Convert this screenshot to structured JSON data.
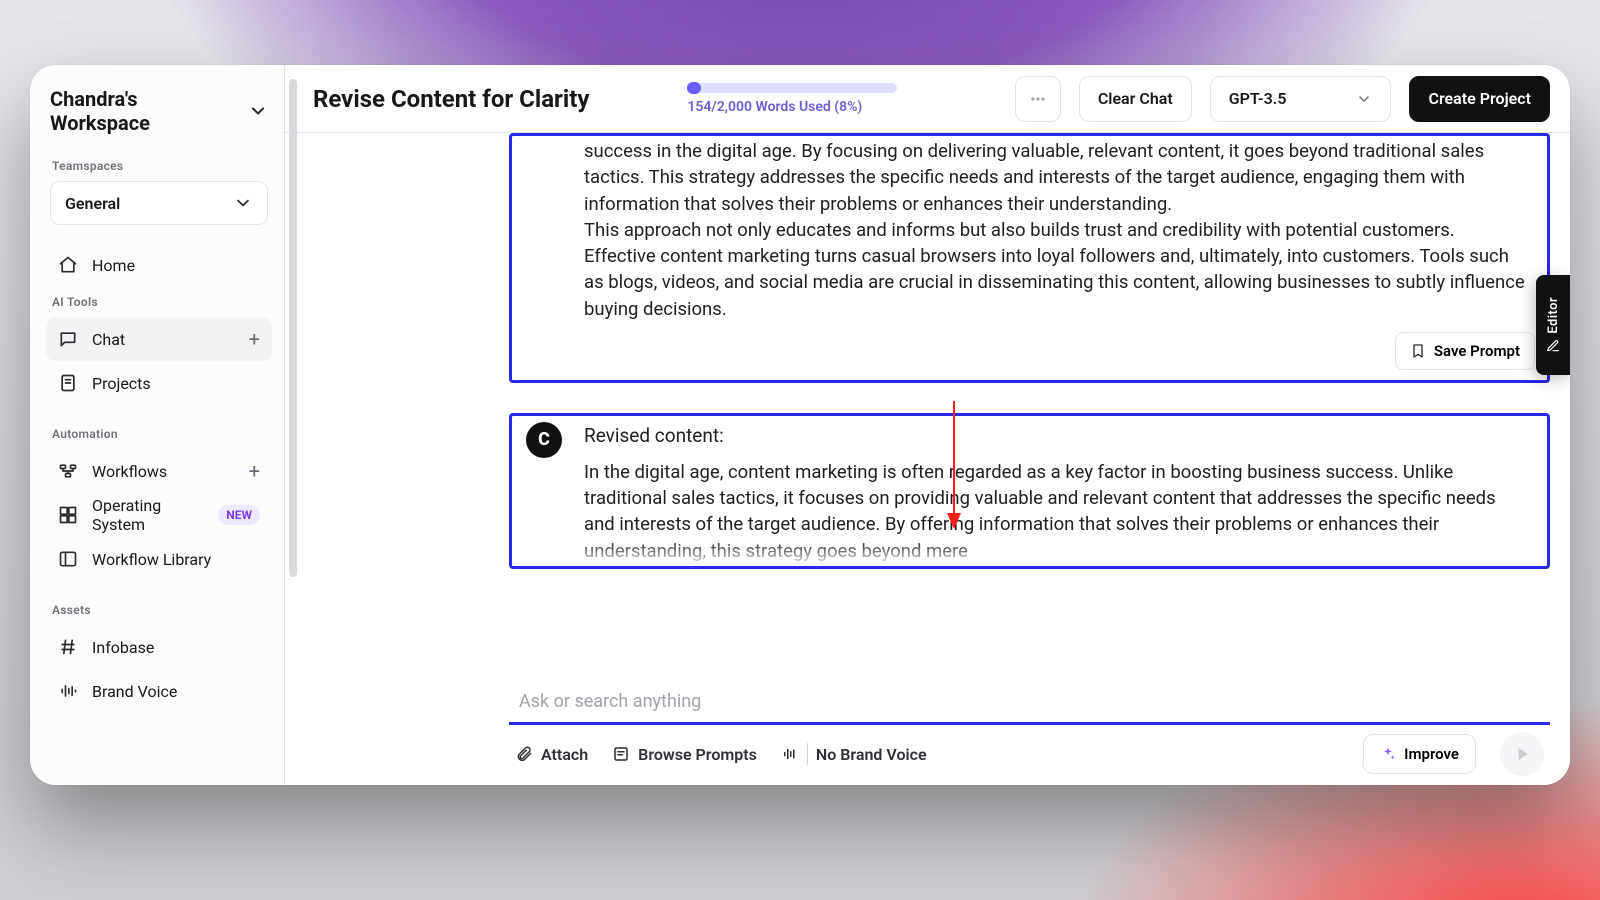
{
  "sidebar": {
    "workspace": "Chandra's Workspace",
    "teamspaces_label": "Teamspaces",
    "teamspace_selected": "General",
    "home": "Home",
    "ai_tools_label": "AI Tools",
    "chat": "Chat",
    "projects": "Projects",
    "automation_label": "Automation",
    "workflows": "Workflows",
    "operating_system": "Operating System",
    "new_badge": "NEW",
    "workflow_library": "Workflow Library",
    "assets_label": "Assets",
    "infobase": "Infobase",
    "brand_voice": "Brand Voice"
  },
  "header": {
    "title": "Revise Content for Clarity",
    "usage_text": "154/2,000 Words Used (8%)",
    "usage_pct": 8,
    "clear_chat": "Clear Chat",
    "model": "GPT-3.5",
    "create_project": "Create Project"
  },
  "chat": {
    "prompt_text": "success in the digital age. By focusing on delivering valuable, relevant content, it goes beyond traditional sales tactics. This strategy addresses the specific needs and interests of the target audience, engaging them with information that solves their problems or enhances their understanding.\nThis approach not only educates and informs but also builds trust and credibility with potential customers. Effective content marketing turns casual browsers into loyal followers and, ultimately, into customers. Tools such as blogs, videos, and social media are crucial in disseminating this content, allowing businesses to subtly influence buying decisions.",
    "save_prompt": "Save Prompt",
    "avatar_letter": "C",
    "revised_heading": "Revised content:",
    "revised_text": "In the digital age, content marketing is often regarded as a key factor in boosting business success. Unlike traditional sales tactics, it focuses on providing valuable and relevant content that addresses the specific needs and interests of the target audience. By offering information that solves their problems or enhances their understanding, this strategy goes beyond mere"
  },
  "composer": {
    "placeholder": "Ask or search anything",
    "attach": "Attach",
    "browse": "Browse Prompts",
    "no_brand": "No Brand Voice",
    "improve": "Improve"
  },
  "right_tab": "Editor"
}
